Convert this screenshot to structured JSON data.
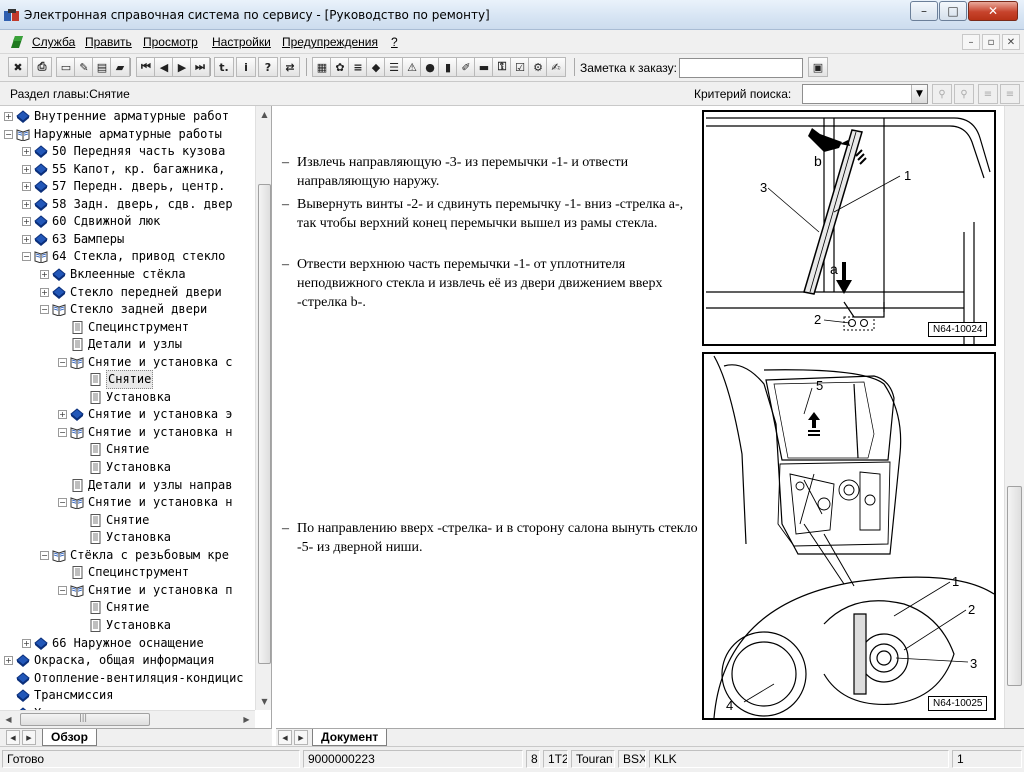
{
  "window": {
    "title": "Электронная справочная система по сервису - [Руководство по ремонту]",
    "controls": {
      "minimize": "–",
      "maximize": "□",
      "close": "✕"
    },
    "mdi_controls": {
      "minimize": "–",
      "restore": "▫",
      "close": "✕"
    }
  },
  "menu": {
    "items": [
      {
        "label": "Служба"
      },
      {
        "label": "Править"
      },
      {
        "label": "Просмотр"
      },
      {
        "label": "Настройки"
      },
      {
        "label": "Предупреждения"
      },
      {
        "label": "?"
      }
    ]
  },
  "toolbar": {
    "buttons": [
      {
        "name": "exit-icon",
        "glyph": "✖"
      },
      {
        "name": "print-icon",
        "glyph": "⎙"
      },
      {
        "name": "page-icon",
        "glyph": "▭"
      },
      {
        "name": "edit-page-icon",
        "glyph": "✎"
      },
      {
        "name": "document-icon",
        "glyph": "▤"
      },
      {
        "name": "car-icon",
        "glyph": "▰"
      },
      {
        "name": "first-page-icon",
        "glyph": "⏮"
      },
      {
        "name": "previous-icon",
        "glyph": "◀"
      },
      {
        "name": "next-icon",
        "glyph": "▶"
      },
      {
        "name": "last-page-icon",
        "glyph": "⏭"
      },
      {
        "name": "back-icon",
        "glyph": "t."
      },
      {
        "name": "info-icon",
        "glyph": "i"
      },
      {
        "name": "help-icon",
        "glyph": "?"
      },
      {
        "name": "sync-icon",
        "glyph": "⇄"
      },
      {
        "name": "calculator-icon",
        "glyph": "▦"
      },
      {
        "name": "engine-icon",
        "glyph": "✿"
      },
      {
        "name": "wiring-icon",
        "glyph": "≡"
      },
      {
        "name": "book-icon",
        "glyph": "◆"
      },
      {
        "name": "list-icon",
        "glyph": "☰"
      },
      {
        "name": "warning-icon",
        "glyph": "⚠"
      },
      {
        "name": "globe-icon",
        "glyph": "●"
      },
      {
        "name": "battery-icon",
        "glyph": "▮"
      },
      {
        "name": "tool-icon",
        "glyph": "✐"
      },
      {
        "name": "vehicle-icon",
        "glyph": "▬"
      },
      {
        "name": "key-icon",
        "glyph": "⚿"
      },
      {
        "name": "checklist-icon",
        "glyph": "☑"
      },
      {
        "name": "settings-icon",
        "glyph": "⚙"
      },
      {
        "name": "note-icon",
        "glyph": "✍"
      }
    ],
    "order_note_label": "Заметка к заказу:",
    "order_note_value": "",
    "extra_button_glyph": "▣"
  },
  "section_bar": {
    "chapter_label": "Раздел главы:Снятие",
    "search_label": "Критерий  поиска:",
    "search_value": "",
    "dropdown_glyph": "▼",
    "search_buttons": [
      "⚲",
      "⚲",
      "≡",
      "≡"
    ]
  },
  "tree": {
    "items": [
      {
        "level": 0,
        "expander": "+",
        "icon": "book-closed",
        "label": "Внутренние арматурные работ"
      },
      {
        "level": 0,
        "expander": "−",
        "icon": "book-open",
        "label": "Наружные арматурные работы"
      },
      {
        "level": 1,
        "expander": "+",
        "icon": "book-closed",
        "label": "50 Передняя часть кузова"
      },
      {
        "level": 1,
        "expander": "+",
        "icon": "book-closed",
        "label": "55 Капот, кр. багажника,"
      },
      {
        "level": 1,
        "expander": "+",
        "icon": "book-closed",
        "label": "57 Передн. дверь, центр."
      },
      {
        "level": 1,
        "expander": "+",
        "icon": "book-closed",
        "label": "58 Задн. дверь, сдв. двер"
      },
      {
        "level": 1,
        "expander": "+",
        "icon": "book-closed",
        "label": "60 Сдвижной люк"
      },
      {
        "level": 1,
        "expander": "+",
        "icon": "book-closed",
        "label": "63 Бамперы"
      },
      {
        "level": 1,
        "expander": "−",
        "icon": "book-open",
        "label": "64 Стекла, привод стекло"
      },
      {
        "level": 2,
        "expander": "+",
        "icon": "book-closed",
        "label": "Вклеенные стёкла"
      },
      {
        "level": 2,
        "expander": "+",
        "icon": "book-closed",
        "label": "Стекло передней двери"
      },
      {
        "level": 2,
        "expander": "−",
        "icon": "book-open",
        "label": "Стекло задней двери"
      },
      {
        "level": 3,
        "expander": "",
        "icon": "page",
        "label": "Специнструмент"
      },
      {
        "level": 3,
        "expander": "",
        "icon": "page",
        "label": "Детали и узлы"
      },
      {
        "level": 3,
        "expander": "−",
        "icon": "book-open",
        "label": "Снятие и установка с"
      },
      {
        "level": 4,
        "expander": "",
        "icon": "page",
        "label": "Снятие",
        "selected": true
      },
      {
        "level": 4,
        "expander": "",
        "icon": "page",
        "label": "Установка"
      },
      {
        "level": 3,
        "expander": "+",
        "icon": "book-closed",
        "label": "Снятие и установка э"
      },
      {
        "level": 3,
        "expander": "−",
        "icon": "book-open",
        "label": "Снятие и установка н"
      },
      {
        "level": 4,
        "expander": "",
        "icon": "page",
        "label": "Снятие"
      },
      {
        "level": 4,
        "expander": "",
        "icon": "page",
        "label": "Установка"
      },
      {
        "level": 3,
        "expander": "",
        "icon": "page",
        "label": "Детали и узлы направ"
      },
      {
        "level": 3,
        "expander": "−",
        "icon": "book-open",
        "label": "Снятие и установка н"
      },
      {
        "level": 4,
        "expander": "",
        "icon": "page",
        "label": "Снятие"
      },
      {
        "level": 4,
        "expander": "",
        "icon": "page",
        "label": "Установка"
      },
      {
        "level": 2,
        "expander": "−",
        "icon": "book-open",
        "label": "Стёкла с резьбовым кре"
      },
      {
        "level": 3,
        "expander": "",
        "icon": "page",
        "label": "Специнструмент"
      },
      {
        "level": 3,
        "expander": "−",
        "icon": "book-open",
        "label": "Снятие и установка п"
      },
      {
        "level": 4,
        "expander": "",
        "icon": "page",
        "label": "Снятие"
      },
      {
        "level": 4,
        "expander": "",
        "icon": "page",
        "label": "Установка"
      },
      {
        "level": 1,
        "expander": "+",
        "icon": "book-closed",
        "label": "66 Наружное оснащение"
      },
      {
        "level": 0,
        "expander": "+",
        "icon": "book-closed",
        "label": "Окраска, общая информация"
      },
      {
        "level": 0,
        "expander": "",
        "icon": "book-closed",
        "label": "Отопление-вентиляция-кондицис"
      },
      {
        "level": 0,
        "expander": "",
        "icon": "book-closed",
        "label": "Трансмиссия"
      },
      {
        "level": 0,
        "expander": "",
        "icon": "book-closed",
        "label": "Ходовая часть"
      }
    ]
  },
  "content": {
    "steps": [
      {
        "dash": "–",
        "text": "Извлечь направляющую -3- из перемычки -1- и отвести направляющую наружу."
      },
      {
        "dash": "–",
        "text": "Выверну‌ть винты -2- и сдвинуть перемычку -1- вниз -стрелка а-, так чтобы верхний конец перемычки вышел из рамы стекла."
      },
      {
        "dash": "–",
        "text": "Отвести верхнюю часть перемычки -1- от уплотнителя неподвижного стекла и извлечь её из двери движением вверх -стрелка b-."
      },
      {
        "dash": "–",
        "text": "По направлению вверх -стрелка- и в сторону салона вынуть стекло -5- из дверной ниши."
      }
    ],
    "figure1": {
      "code": "N64-10024",
      "callouts": {
        "c1": "1",
        "c2": "2",
        "c3": "3",
        "a": "a",
        "b": "b"
      }
    },
    "figure2": {
      "code": "N64-10025",
      "callouts": {
        "c1": "1",
        "c2": "2",
        "c3": "3",
        "c4": "4",
        "c5": "5"
      }
    }
  },
  "tabs": {
    "left": [
      {
        "label": "Обзор",
        "active": true
      }
    ],
    "right": [
      {
        "label": "Документ",
        "active": true
      }
    ],
    "nav": [
      "◀",
      "▶"
    ],
    "hscroll_grip": "|||"
  },
  "status": {
    "state": "Готово",
    "vin": "9000000223",
    "field1": "8",
    "field2": "1T2",
    "model": "Touran",
    "field3": "BSX",
    "field4": "KLK",
    "page": "1"
  },
  "colors": {
    "book": "#2257b8",
    "book_spine": "#0b2f7a",
    "selection": "#e9e9e9"
  }
}
